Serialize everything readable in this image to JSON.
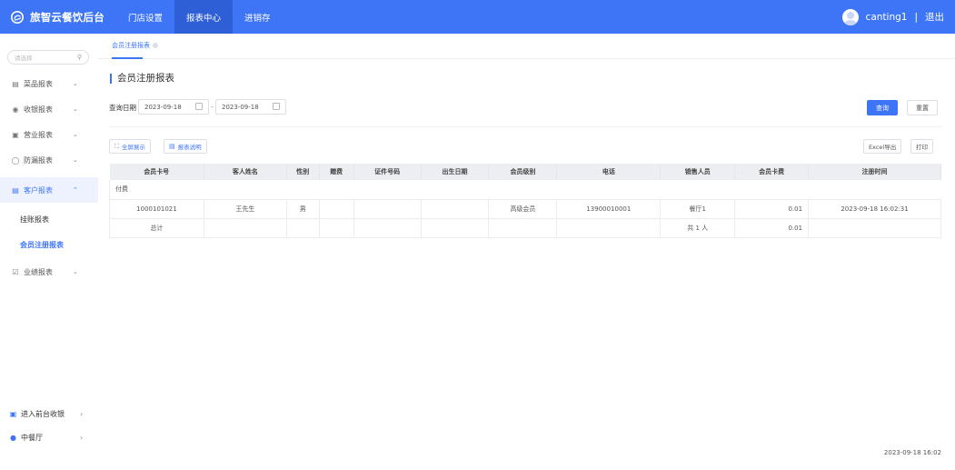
{
  "app": {
    "brand": "旅智云餐饮后台",
    "colors": {
      "primary": "#3e75f6",
      "topbar": "#3e75f6",
      "active_nav": "#2f5fd6"
    }
  },
  "topnav": {
    "items": [
      {
        "label": "门店设置"
      },
      {
        "label": "报表中心"
      },
      {
        "label": "进销存"
      }
    ],
    "active": "报表中心"
  },
  "user": {
    "name": "canting1",
    "separator": "|",
    "logout": "退出"
  },
  "sidebar": {
    "search_placeholder": "请选择",
    "items": [
      {
        "label": "菜品报表",
        "icon": "dish-report-icon"
      },
      {
        "label": "收银报表",
        "icon": "cashier-report-icon"
      },
      {
        "label": "营业报表",
        "icon": "business-report-icon"
      },
      {
        "label": "防漏报表",
        "icon": "leak-report-icon"
      },
      {
        "label": "客户报表",
        "icon": "customer-report-icon"
      },
      {
        "label": "业绩报表",
        "icon": "performance-report-icon"
      }
    ],
    "sub_items": [
      {
        "label": "挂账报表"
      },
      {
        "label": "会员注册报表"
      }
    ],
    "bottom": [
      {
        "label": "进入前台收银",
        "icon": "pos-icon"
      },
      {
        "label": "中餐厅",
        "icon": "location-icon"
      }
    ]
  },
  "main": {
    "tab_label": "会员注册报表",
    "page_title": "会员注册报表",
    "filter": {
      "label": "查询日期",
      "start_date": "2023-09-18",
      "end_date": "2023-09-18",
      "separator": "-"
    },
    "buttons": {
      "query": "查询",
      "reset": "重置",
      "fullscreen": "全屏展示",
      "report_desc": "报表说明",
      "excel": "Excel导出",
      "print": "打印"
    },
    "table": {
      "columns": [
        "会员卡号",
        "客人姓名",
        "性别",
        "赠费",
        "证件号码",
        "出生日期",
        "会员级别",
        "电话",
        "销售人员",
        "会员卡费",
        "注册时间"
      ],
      "group_label": "付费",
      "rows": [
        [
          "1000101021",
          "王先生",
          "男",
          "",
          "",
          "",
          "高级会员",
          "13900010001",
          "餐厅1",
          "0.01",
          "2023-09-18 16:02:31"
        ]
      ],
      "total": [
        "总计",
        "",
        "",
        "",
        "",
        "",
        "",
        "",
        "共 1 人",
        "0.01",
        ""
      ]
    },
    "footer_time": "2023-09-18 16:02"
  }
}
